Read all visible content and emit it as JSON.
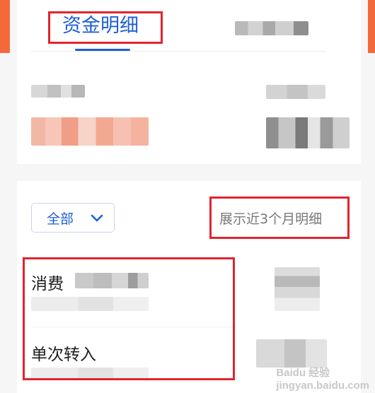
{
  "header": {
    "tab_label": "资金明细"
  },
  "filter": {
    "label": "全部",
    "icon": "chevron-down-icon"
  },
  "range_note": "展示近3个月明细",
  "transactions": [
    {
      "title": "消费"
    },
    {
      "title": "单次转入"
    }
  ],
  "watermark": {
    "brand": "Baidu 经验",
    "url": "jingyan.baidu.com"
  },
  "colors": {
    "accent": "#1f5fd1",
    "highlight": "#e1242e",
    "edge": "#f36a3a"
  }
}
